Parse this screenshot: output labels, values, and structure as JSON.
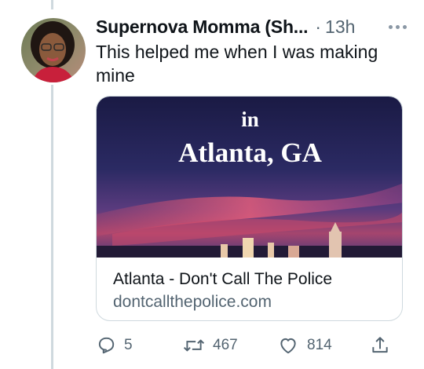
{
  "tweet": {
    "display_name": "Supernova Momma (Sh...",
    "separator": "·",
    "timestamp": "13h",
    "text": "This helped me when I was making mine",
    "icons": {
      "avatar": "avatar-photo",
      "more": "more-dots-icon"
    }
  },
  "card": {
    "image_line1": "in",
    "image_line2": "Atlanta, GA",
    "title": "Atlanta - Don't Call The Police",
    "domain": "dontcallthepolice.com"
  },
  "actions": {
    "reply_count": "5",
    "retweet_count": "467",
    "like_count": "814",
    "icons": {
      "reply": "reply-icon",
      "retweet": "retweet-icon",
      "like": "heart-icon",
      "share": "share-icon"
    }
  },
  "colors": {
    "text_primary": "#0f1419",
    "text_secondary": "#536471",
    "border": "#cfd9de",
    "card_sky_top": "#1c1d4a",
    "card_sky_glow": "#d1456a"
  }
}
